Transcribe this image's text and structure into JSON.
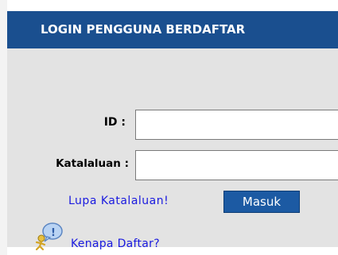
{
  "panel": {
    "title": "LOGIN PENGGUNA BERDAFTAR"
  },
  "form": {
    "id_label": "ID :",
    "password_label": "Katalaluan :",
    "id_value": "",
    "password_value": "",
    "forgot_link": "Lupa Katalaluan!",
    "submit_label": "Masuk"
  },
  "help": {
    "icon": "help-person-icon",
    "link": "Kenapa Daftar?"
  },
  "colors": {
    "header_bg": "#1a4f8f",
    "panel_bg": "#e3e3e3",
    "link": "#1a1adf",
    "button_bg": "#1c5aa3"
  }
}
